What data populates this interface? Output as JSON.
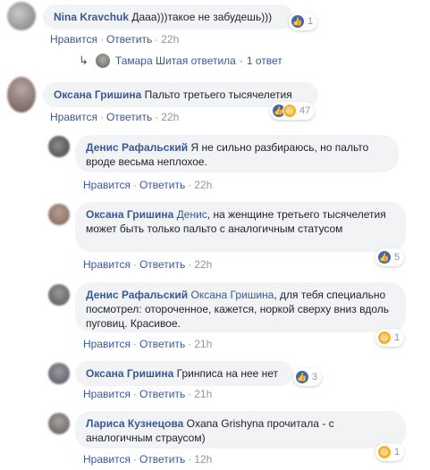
{
  "actions": {
    "like": "Нравится",
    "reply": "Ответить",
    "sep": "·"
  },
  "comments": [
    {
      "author": "Nina Kravchuk",
      "text": "Дааа)))такое не забудешь)))",
      "time": "22h",
      "reactions": "1"
    },
    {
      "author": "Оксана Гришина",
      "text": "Пальто третьего тысячелетия",
      "time": "22h",
      "reactions": "47"
    }
  ],
  "reply_summary": {
    "author": "Тамара Шитая",
    "action": "ответила",
    "count": "1 ответ"
  },
  "replies": [
    {
      "author": "Денис Рафальский",
      "text": "Я не сильно разбираюсь, но пальто вроде весьма неплохое.",
      "time": "22h"
    },
    {
      "author": "Оксана Гришина",
      "mention": "Денис",
      "text": ", на женщине третьего тысячелетия может быть только пальто с аналогичным статусом",
      "time": "22h",
      "reactions": "5"
    },
    {
      "author": "Денис Рафальский",
      "mention": "Оксана Гришина",
      "text": ", для тебя специально посмотрел: отороченное, кажется, норкой сверху вниз вдоль пуговиц. Красивое.",
      "time": "21h",
      "reactions": "1"
    },
    {
      "author": "Оксана Гришина",
      "text": "Гринписа на нее нет",
      "time": "21h",
      "reactions": "3"
    },
    {
      "author": "Лариса Кузнецова",
      "text": "Oxana Grishyna прочитала - с аналогичным страусом)",
      "time": "12h",
      "reactions": "1"
    }
  ],
  "colors": {
    "link": "#385898",
    "bubble": "#f2f3f5",
    "meta": "#90949c",
    "like": "#4267b2",
    "haha": "#f7b125"
  }
}
